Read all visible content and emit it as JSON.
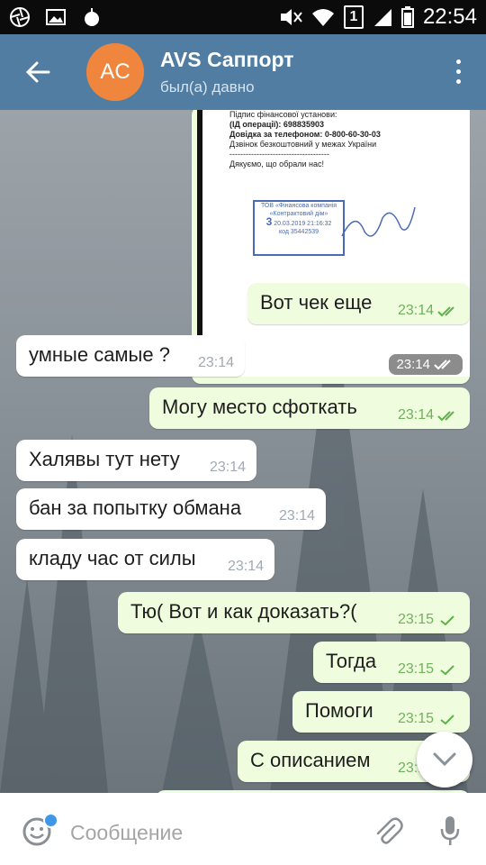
{
  "status_bar": {
    "time": "22:54",
    "sim": "1"
  },
  "header": {
    "avatar_initials": "AC",
    "title": "AVS Саппорт",
    "subtitle": "был(а) давно"
  },
  "image_message": {
    "receipt_lines": [
      "Підпис фінансової установи:",
      "(ІД операції): 698835903",
      "Довідка за телефоном: 0-800-60-30-03",
      "Дзвінок безкоштовний у межах України",
      "-------------------------------------",
      "Дякуємо, що обрали нас!"
    ],
    "stamp_line1": "ТОВ «Фінансова компанія",
    "stamp_line2": "«Контрактовий дім»",
    "stamp_number": "3",
    "stamp_datetime": "20.03.2019 21:16:32",
    "stamp_code": "код 35442539",
    "time": "23:14"
  },
  "messages": [
    {
      "text": "Вот чек еще",
      "time": "23:14",
      "direction": "out",
      "status": "read"
    },
    {
      "text": "умные самые ?",
      "time": "23:14",
      "direction": "in"
    },
    {
      "text": "Могу место сфоткать",
      "time": "23:14",
      "direction": "out",
      "status": "read"
    },
    {
      "text": "Халявы тут нету",
      "time": "23:14",
      "direction": "in"
    },
    {
      "text": "бан за попытку обмана",
      "time": "23:14",
      "direction": "in"
    },
    {
      "text": "кладу час от силы",
      "time": "23:14",
      "direction": "in"
    },
    {
      "text": "Тю( Вот и как доказать?(",
      "time": "23:15",
      "direction": "out",
      "status": "sent"
    },
    {
      "text": "Тогда",
      "time": "23:15",
      "direction": "out",
      "status": "sent"
    },
    {
      "text": "Помоги",
      "time": "23:15",
      "direction": "out",
      "status": "sent"
    },
    {
      "text": "С описанием",
      "time": "23:15",
      "direction": "out",
      "status": "sent"
    }
  ],
  "input": {
    "placeholder": "Сообщение"
  },
  "icons": {
    "back": "arrow-left-icon",
    "menu": "more-vertical-icon",
    "emoji": "emoji-icon",
    "attach": "paperclip-icon",
    "mic": "microphone-icon",
    "scroll": "chevron-down-icon"
  },
  "colors": {
    "header": "#517da2",
    "avatar": "#f0863e",
    "outgoing_bubble": "#effdde",
    "incoming_bubble": "#ffffff",
    "check_green": "#5fb24a"
  }
}
